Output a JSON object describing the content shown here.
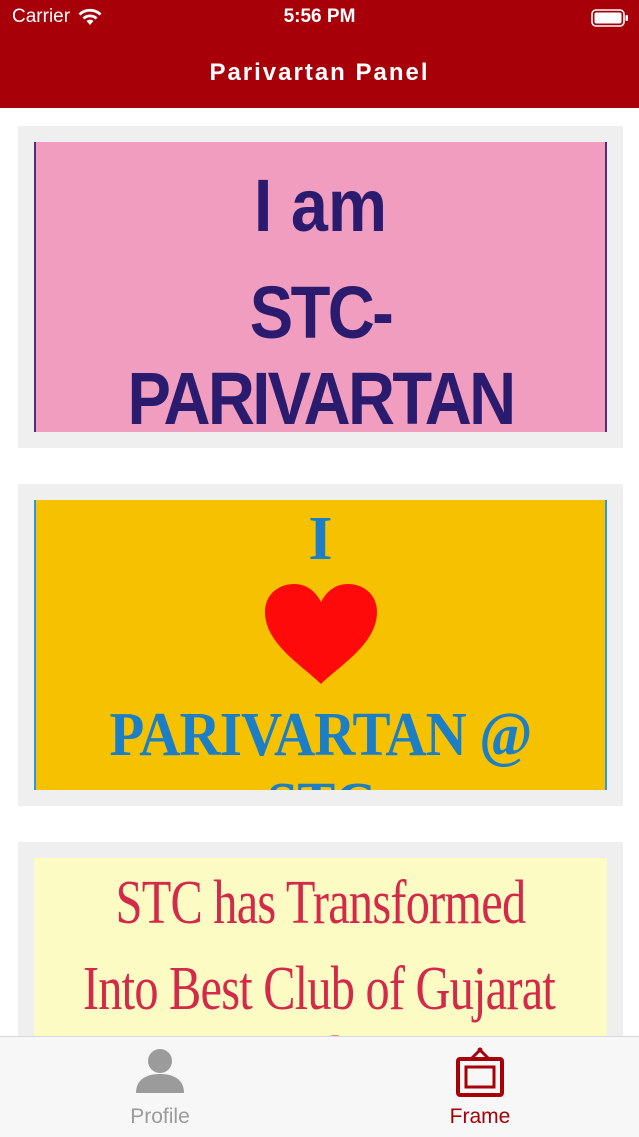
{
  "status_bar": {
    "carrier": "Carrier",
    "time": "5:56 PM"
  },
  "nav": {
    "title": "Parivartan Panel"
  },
  "frames": [
    {
      "lines": [
        "I am",
        "STC-PARIVARTAN"
      ],
      "background": "#f19dbf",
      "text_color": "#2b1b6e"
    },
    {
      "lines": [
        "I",
        "PARIVARTAN @ STC"
      ],
      "icon": "heart-icon",
      "background": "#f6c200",
      "text_color": "#1c7fc6",
      "heart_color": "#ff0a0a"
    },
    {
      "lines": [
        "STC has Transformed",
        "Into Best Club of Gujarat Under"
      ],
      "background": "#fdfbc4",
      "text_color": "#d42a4a"
    }
  ],
  "tabs": [
    {
      "label": "Profile",
      "icon": "person-icon",
      "selected": false,
      "color": "#9b9b9b"
    },
    {
      "label": "Frame",
      "icon": "frame-icon",
      "selected": true,
      "color": "#a80009"
    }
  ],
  "colors": {
    "brand": "#a80009",
    "card_background": "#efefef",
    "tabbar_background": "#f7f7f7"
  }
}
